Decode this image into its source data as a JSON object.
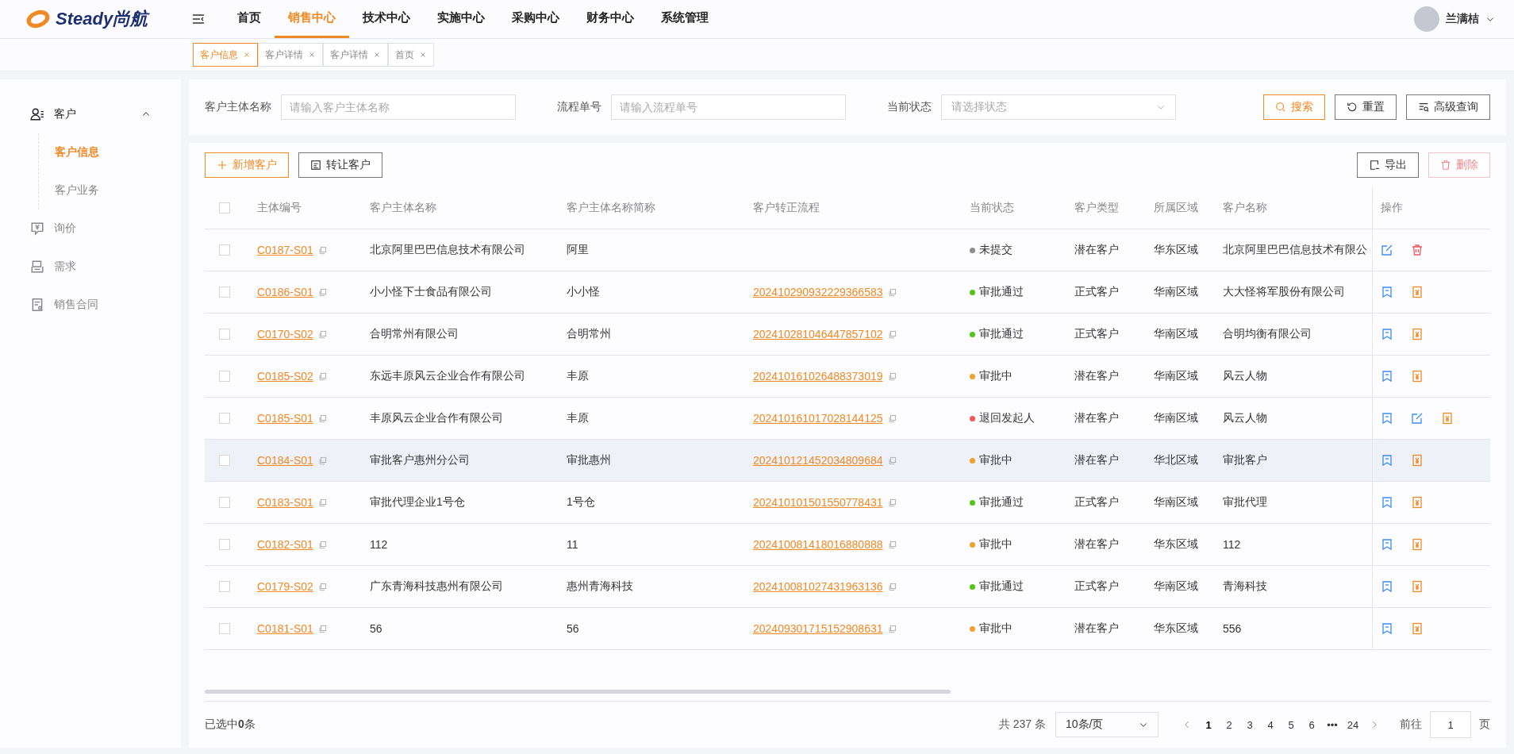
{
  "header": {
    "logo": "Steady尚航",
    "nav": [
      {
        "label": "首页",
        "selected": false
      },
      {
        "label": "销售中心",
        "selected": true
      },
      {
        "label": "技术中心",
        "selected": false
      },
      {
        "label": "实施中心",
        "selected": false
      },
      {
        "label": "采购中心",
        "selected": false
      },
      {
        "label": "财务中心",
        "selected": false
      },
      {
        "label": "系统管理",
        "selected": false
      }
    ],
    "user": {
      "name": "兰满桔"
    }
  },
  "tabs": [
    {
      "label": "客户信息",
      "selected": true
    },
    {
      "label": "客户详情",
      "selected": false
    },
    {
      "label": "客户详情",
      "selected": false
    },
    {
      "label": "首页",
      "selected": false
    }
  ],
  "sidebar": {
    "items": [
      {
        "label": "客户",
        "expanded": true,
        "children": [
          {
            "label": "客户信息",
            "selected": true
          },
          {
            "label": "客户业务",
            "selected": false
          }
        ]
      },
      {
        "label": "询价",
        "selected": false
      },
      {
        "label": "需求",
        "selected": false
      },
      {
        "label": "销售合同",
        "selected": false
      }
    ]
  },
  "filters": [
    {
      "kind": "input",
      "label": "客户主体名称",
      "placeholder": "请输入客户主体名称"
    },
    {
      "kind": "input",
      "label": "流程单号",
      "placeholder": "请输入流程单号"
    },
    {
      "kind": "select",
      "label": "当前状态",
      "placeholder": "请选择状态"
    }
  ],
  "filter_buttons": [
    {
      "kind": "search",
      "label": "搜索"
    },
    {
      "kind": "reset",
      "label": "重置"
    },
    {
      "kind": "advanced",
      "label": "高级查询"
    }
  ],
  "toolbar": {
    "left": [
      {
        "kind": "add",
        "label": "新增客户",
        "disabled": false
      },
      {
        "kind": "transfer",
        "label": "转让客户",
        "disabled": false
      }
    ],
    "right": [
      {
        "kind": "export",
        "label": "导出",
        "disabled": false
      },
      {
        "kind": "delete",
        "label": "删除",
        "disabled": true
      }
    ]
  },
  "table": {
    "select_all": {
      "checked": false
    },
    "columns": [
      "主体编号",
      "客户主体名称",
      "客户主体名称简称",
      "客户转正流程",
      "当前状态",
      "客户类型",
      "所属区域",
      "客户名称",
      "操作"
    ],
    "rows": [
      {
        "checked": false,
        "hovered": false,
        "code": "C0187-S01",
        "name": "北京阿里巴巴信息技术有限公司",
        "short": "阿里",
        "flow": "",
        "status": {
          "label": "未提交",
          "color": "#8c8c8c"
        },
        "type": "潜在客户",
        "region": "华东区域",
        "customer": "北京阿里巴巴信息技术有限公",
        "actions": [
          {
            "kind": "edit"
          },
          {
            "kind": "delete"
          }
        ]
      },
      {
        "checked": false,
        "hovered": false,
        "code": "C0186-S01",
        "name": "小小怪下士食品有限公司",
        "short": "小小怪",
        "flow": "202410290932229366583",
        "status": {
          "label": "审批通过",
          "color": "#52c41a"
        },
        "type": "正式客户",
        "region": "华南区域",
        "customer": "大大怪将军股份有限公司",
        "actions": [
          {
            "kind": "review"
          },
          {
            "kind": "fee"
          }
        ]
      },
      {
        "checked": false,
        "hovered": false,
        "code": "C0170-S02",
        "name": "合明常州有限公司",
        "short": "合明常州",
        "flow": "202410281046447857102",
        "status": {
          "label": "审批通过",
          "color": "#52c41a"
        },
        "type": "正式客户",
        "region": "华南区域",
        "customer": "合明均衡有限公司",
        "actions": [
          {
            "kind": "review"
          },
          {
            "kind": "fee"
          }
        ]
      },
      {
        "checked": false,
        "hovered": false,
        "code": "C0185-S02",
        "name": "东远丰原风云企业合作有限公司",
        "short": "丰原",
        "flow": "202410161026488373019",
        "status": {
          "label": "审批中",
          "color": "#f0a030"
        },
        "type": "潜在客户",
        "region": "华南区域",
        "customer": "风云人物",
        "actions": [
          {
            "kind": "review"
          },
          {
            "kind": "fee"
          }
        ]
      },
      {
        "checked": false,
        "hovered": false,
        "code": "C0185-S01",
        "name": "丰原风云企业合作有限公司",
        "short": "丰原",
        "flow": "202410161017028144125",
        "status": {
          "label": "退回发起人",
          "color": "#f5555b"
        },
        "type": "潜在客户",
        "region": "华南区域",
        "customer": "风云人物",
        "actions": [
          {
            "kind": "review"
          },
          {
            "kind": "edit"
          },
          {
            "kind": "fee"
          }
        ]
      },
      {
        "checked": false,
        "hovered": true,
        "code": "C0184-S01",
        "name": "审批客户惠州分公司",
        "short": "审批惠州",
        "flow": "202410121452034809684",
        "status": {
          "label": "审批中",
          "color": "#f0a030"
        },
        "type": "潜在客户",
        "region": "华北区域",
        "customer": "审批客户",
        "actions": [
          {
            "kind": "review"
          },
          {
            "kind": "fee"
          }
        ]
      },
      {
        "checked": false,
        "hovered": false,
        "code": "C0183-S01",
        "name": "审批代理企业1号仓",
        "short": "1号仓",
        "flow": "202410101501550778431",
        "status": {
          "label": "审批通过",
          "color": "#52c41a"
        },
        "type": "正式客户",
        "region": "华南区域",
        "customer": "审批代理",
        "actions": [
          {
            "kind": "review"
          },
          {
            "kind": "fee"
          }
        ]
      },
      {
        "checked": false,
        "hovered": false,
        "code": "C0182-S01",
        "name": "112",
        "short": "11",
        "flow": "202410081418016880888",
        "status": {
          "label": "审批中",
          "color": "#f0a030"
        },
        "type": "潜在客户",
        "region": "华东区域",
        "customer": "112",
        "actions": [
          {
            "kind": "review"
          },
          {
            "kind": "fee"
          }
        ]
      },
      {
        "checked": false,
        "hovered": false,
        "code": "C0179-S02",
        "name": "广东青海科技惠州有限公司",
        "short": "惠州青海科技",
        "flow": "202410081027431963136",
        "status": {
          "label": "审批通过",
          "color": "#52c41a"
        },
        "type": "正式客户",
        "region": "华南区域",
        "customer": "青海科技",
        "actions": [
          {
            "kind": "review"
          },
          {
            "kind": "fee"
          }
        ]
      },
      {
        "checked": false,
        "hovered": false,
        "code": "C0181-S01",
        "name": "56",
        "short": "56",
        "flow": "202409301715152908631",
        "status": {
          "label": "审批中",
          "color": "#f0a030"
        },
        "type": "潜在客户",
        "region": "华东区域",
        "customer": "556",
        "actions": [
          {
            "kind": "review"
          },
          {
            "kind": "fee"
          }
        ]
      }
    ]
  },
  "footer": {
    "selection": "已选中**0**条",
    "total": "共 237 条",
    "page_size": "10条/页",
    "pages": [
      {
        "label": "1",
        "selected": true
      },
      {
        "label": "2",
        "selected": false
      },
      {
        "label": "3",
        "selected": false
      },
      {
        "label": "4",
        "selected": false
      },
      {
        "label": "5",
        "selected": false
      },
      {
        "label": "6",
        "selected": false
      },
      {
        "label": "•••",
        "selected": false
      },
      {
        "label": "24",
        "selected": false
      }
    ],
    "jump": {
      "label": "前往",
      "value": "1",
      "suffix": "页"
    }
  }
}
